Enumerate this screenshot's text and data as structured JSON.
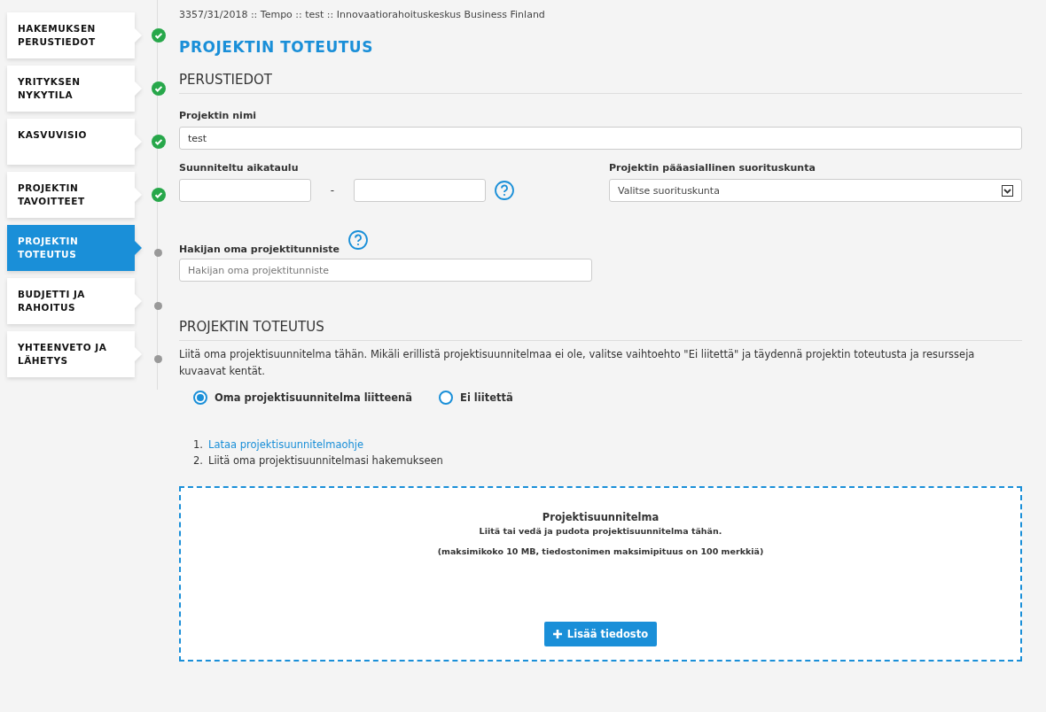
{
  "steps": [
    {
      "label": "HAKEMUKSEN PERUSTIEDOT",
      "selected": false,
      "completed": true
    },
    {
      "label": "YRITYKSEN NYKYTILA",
      "selected": false,
      "completed": true
    },
    {
      "label": "KASVUVISIO",
      "selected": false,
      "completed": true
    },
    {
      "label": "PROJEKTIN TAVOITTEET",
      "selected": false,
      "completed": true
    },
    {
      "label": "PROJEKTIN TOTEUTUS",
      "selected": true,
      "completed": false
    },
    {
      "label": "BUDJETTI JA RAHOITUS",
      "selected": false,
      "completed": false
    },
    {
      "label": "YHTEENVETO JA LÄHETYS",
      "selected": false,
      "completed": false
    }
  ],
  "breadcrumb": "3357/31/2018 :: Tempo :: test :: Innovaatiorahoituskeskus Business Finland",
  "page_title": "PROJEKTIN TOTEUTUS",
  "basic_section": {
    "heading": "PERUSTIEDOT",
    "project_name": {
      "label": "Projektin nimi",
      "value": "test"
    },
    "schedule": {
      "label": "Suunniteltu aikataulu",
      "separator": "-"
    },
    "performer": {
      "label": "Projektin pääasiallinen suorituskunta",
      "placeholder": "Valitse suorituskunta"
    },
    "own_id": {
      "label": "Hakijan oma projektitunniste",
      "placeholder": "Hakijan oma projektitunniste"
    }
  },
  "implementation_section": {
    "heading": "PROJEKTIN TOTEUTUS",
    "description": "Liitä oma projektisuunnitelma tähän. Mikäli erillistä projektisuunnitelmaa ei ole, valitse vaihtoehto \"Ei liitettä\" ja täydennä projektin toteutusta ja resursseja kuvaavat kentät.",
    "options": [
      {
        "label": "Oma projektisuunnitelma liitteenä",
        "selected": true
      },
      {
        "label": "Ei liitettä",
        "selected": false
      }
    ],
    "steps": [
      {
        "number": "1.",
        "text": "Lataa projektisuunnitelmaohje",
        "kind": "link"
      },
      {
        "number": "2.",
        "text": "Liitä oma projektisuunnitelmasi hakemukseen",
        "kind": "text"
      }
    ],
    "dropzone": {
      "title": "Projektisuunnitelma",
      "instruction": "Liitä tai vedä ja pudota projektisuunnitelma tähän.",
      "limits": "(maksimikoko 10 MB, tiedostonimen maksimipituus on 100 merkkiä)",
      "button": "Lisää tiedosto"
    }
  }
}
